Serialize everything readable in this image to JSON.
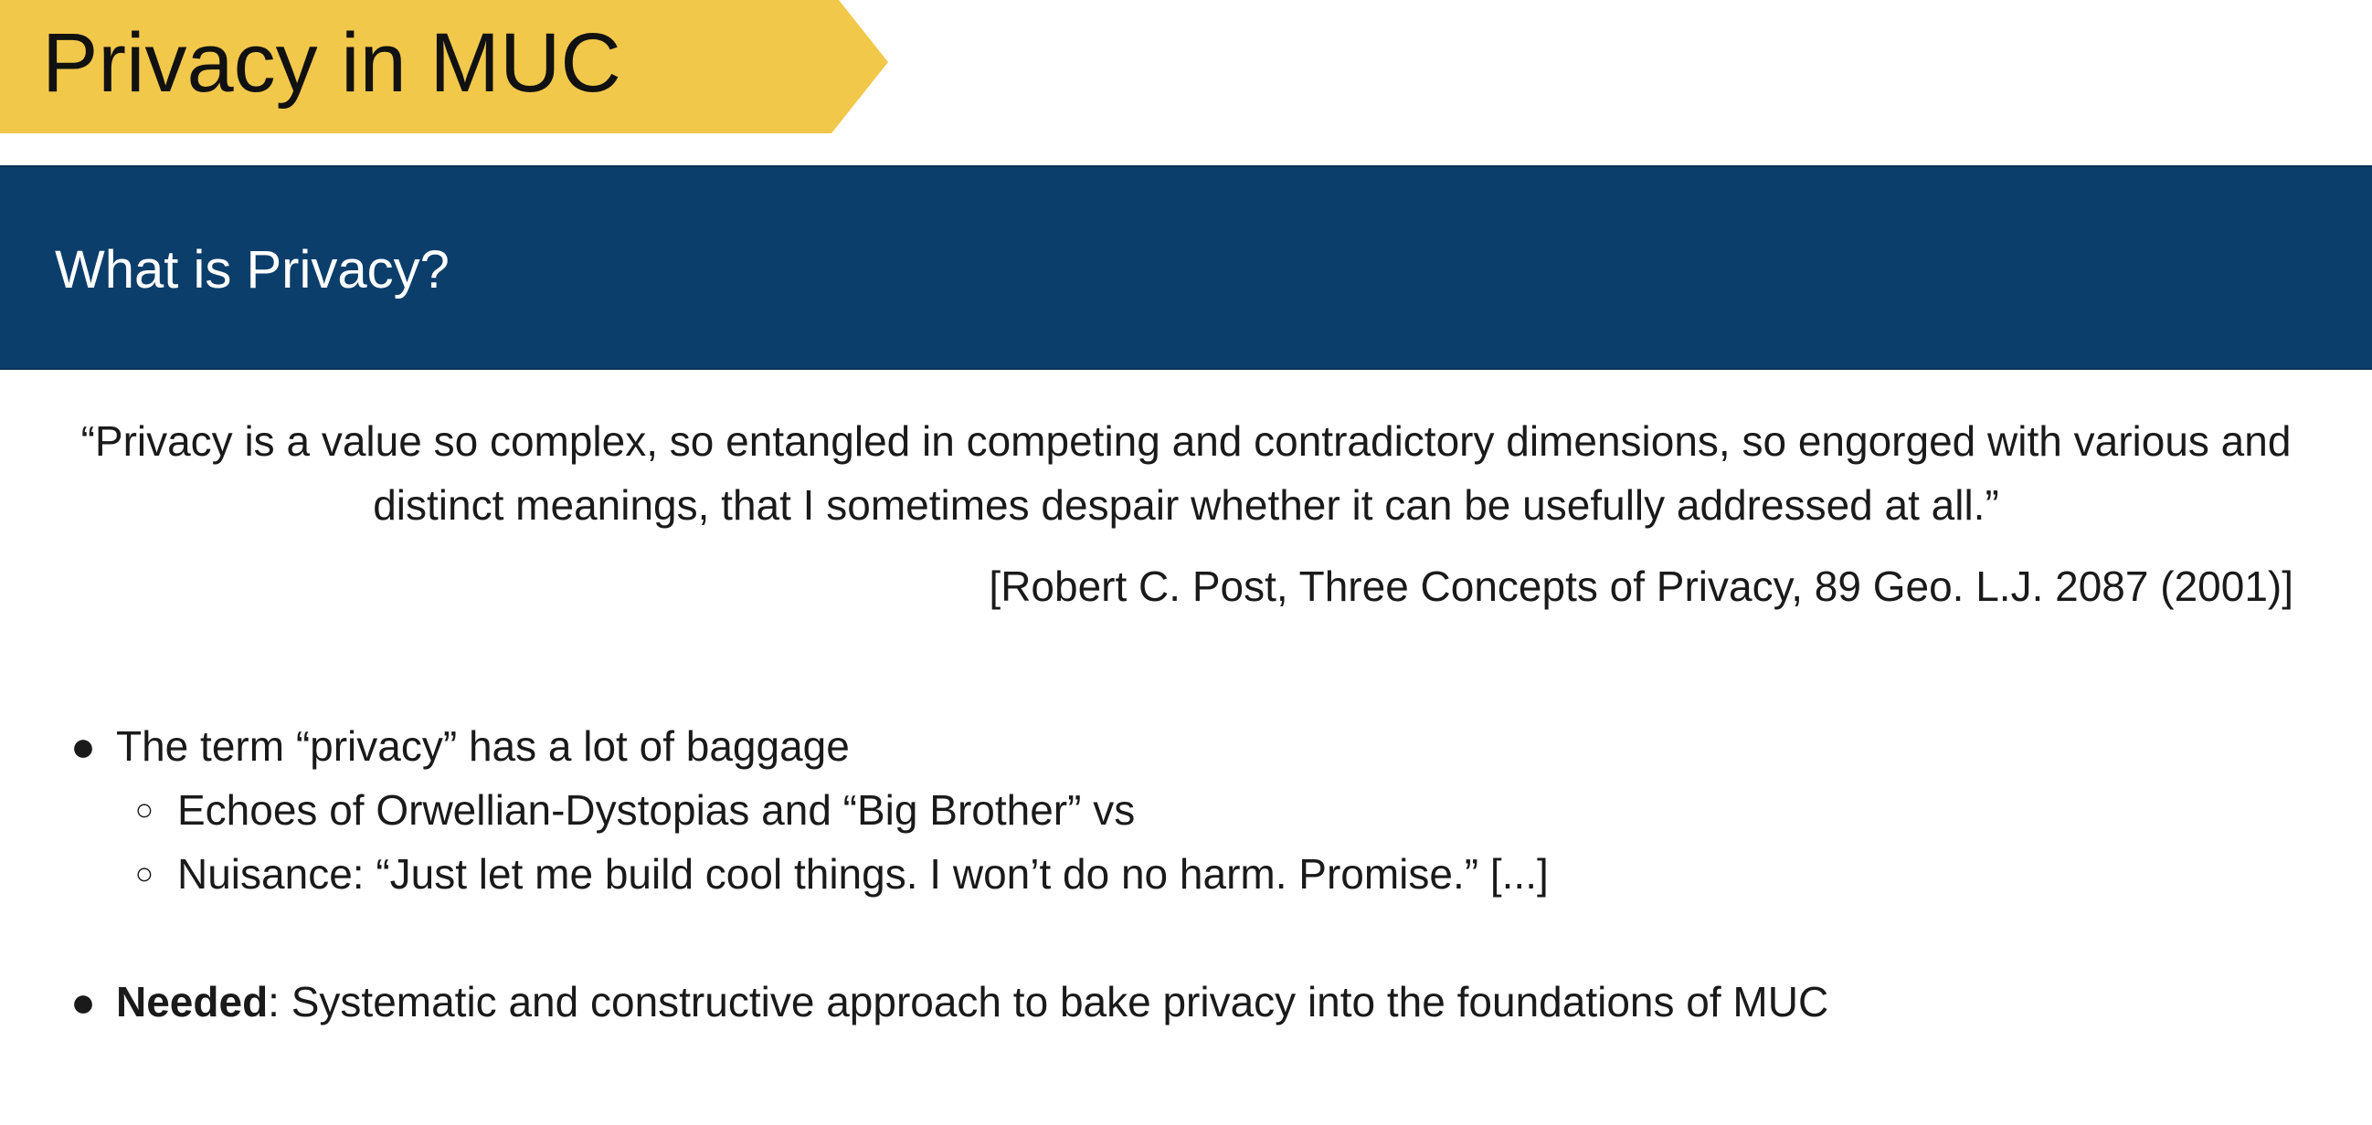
{
  "slide": {
    "title": "Privacy in MUC",
    "section_title": "What is Privacy?",
    "quote": "“Privacy is a value so complex, so entangled in competing and contradictory dimensions, so engorged with various and distinct meanings, that I sometimes despair whether it can be usefully addressed at all.”",
    "citation": "[Robert C. Post, Three Concepts of Privacy, 89 Geo. L.J. 2087 (2001)]",
    "bullets": [
      {
        "marker": "●",
        "text": "The term “privacy” has a lot of baggage",
        "sub": [
          {
            "marker": "○",
            "text": "Echoes of Orwellian-Dystopias and “Big Brother” vs"
          },
          {
            "marker": "○",
            "text": "Nuisance: “Just let me build cool things. I won’t do no harm. Promise.” [...]"
          }
        ]
      },
      {
        "marker": "●",
        "bold_text": "Needed",
        "text": ": Systematic and constructive approach to bake privacy into the foundations of MUC"
      }
    ]
  },
  "colors": {
    "banner_yellow": "#f2c84b",
    "section_blue": "#0c3e6b",
    "text": "#1a1a1a",
    "background": "#ffffff"
  }
}
